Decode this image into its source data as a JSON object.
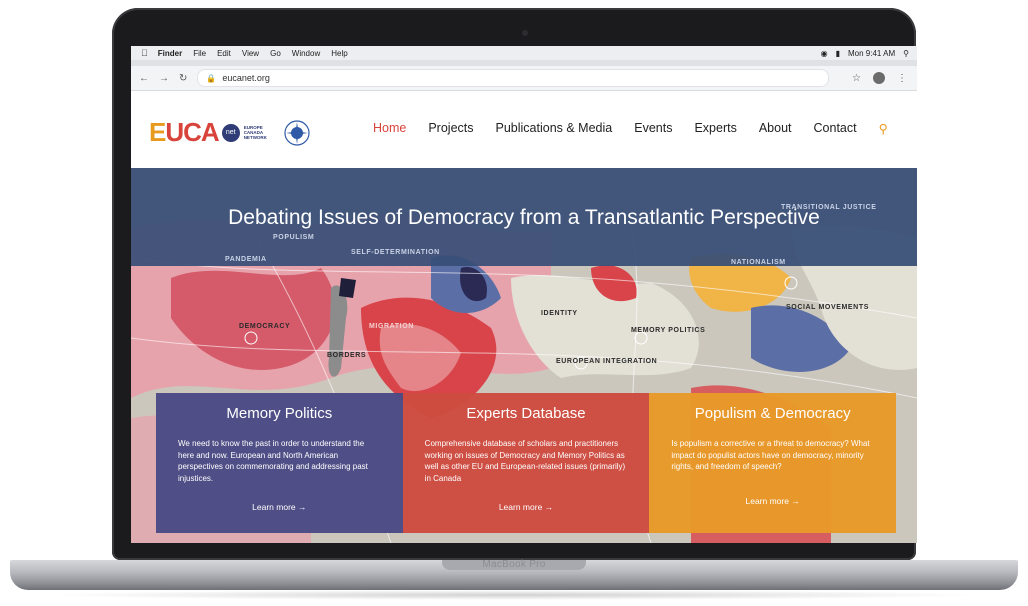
{
  "device": {
    "base_label": "MacBook Pro"
  },
  "mac_menubar": {
    "items": [
      "Finder",
      "File",
      "Edit",
      "View",
      "Go",
      "Window",
      "Help"
    ],
    "clock": "Mon 9:41 AM"
  },
  "browser": {
    "url": "eucanet.org"
  },
  "site": {
    "logo": {
      "e": "E",
      "u": "U",
      "ca": "CA",
      "net": "net",
      "tagline": "EUROPE CANADA NETWORK"
    },
    "nav": [
      "Home",
      "Projects",
      "Publications & Media",
      "Events",
      "Experts",
      "About",
      "Contact"
    ]
  },
  "hero": {
    "title": "Debating Issues of Democracy from a Transatlantic Perspective",
    "map_labels": {
      "transitional_justice": "TRANSITIONAL JUSTICE",
      "populism": "POPULISM",
      "self_determination": "SELF-DETERMINATION",
      "pandemia": "PANDEMIA",
      "nationalism": "NATIONALISM",
      "social_movements": "SOCIAL MOVEMENTS",
      "identity": "IDENTITY",
      "democracy": "DEMOCRACY",
      "migration": "MIGRATION",
      "memory_politics": "MEMORY POLITICS",
      "borders": "BORDERS",
      "european_integration": "EUROPEAN INTEGRATION"
    }
  },
  "cards": [
    {
      "title": "Memory Politics",
      "body": "We need to know the past in order to understand the here and now.  European and North American perspectives on commemorating and addressing past injustices.",
      "link": "Learn more"
    },
    {
      "title": "Experts Database",
      "body": "Comprehensive database of scholars and practitioners working on issues of Democracy and Memory Politics as well as other EU and European-related issues (primarily) in Canada",
      "link": "Learn more"
    },
    {
      "title": "Populism & Democracy",
      "body": "Is populism a corrective or a threat to democracy? What impact do populist actors have on democracy, minority rights, and freedom of speech?",
      "link": "Learn more"
    }
  ]
}
